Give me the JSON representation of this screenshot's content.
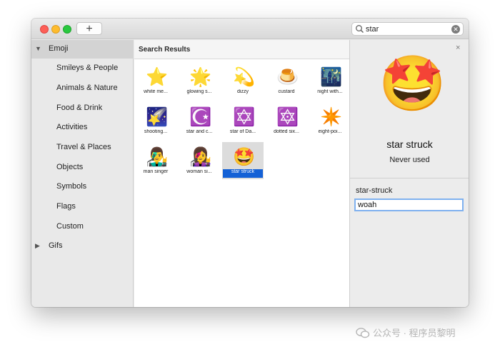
{
  "toolbar": {
    "add_label": "+"
  },
  "search": {
    "value": "star",
    "clear_label": "✕"
  },
  "sidebar": {
    "emoji_header": "Emoji",
    "items": [
      {
        "label": "Smileys & People"
      },
      {
        "label": "Animals & Nature"
      },
      {
        "label": "Food & Drink"
      },
      {
        "label": "Activities"
      },
      {
        "label": "Travel & Places"
      },
      {
        "label": "Objects"
      },
      {
        "label": "Symbols"
      },
      {
        "label": "Flags"
      },
      {
        "label": "Custom"
      }
    ],
    "gifs_label": "Gifs"
  },
  "results": {
    "header": "Search Results",
    "items": [
      {
        "glyph": "⭐",
        "label": "white me..."
      },
      {
        "glyph": "🌟",
        "label": "glowing s..."
      },
      {
        "glyph": "💫",
        "label": "dizzy"
      },
      {
        "glyph": "🍮",
        "label": "custard"
      },
      {
        "glyph": "🌃",
        "label": "night with..."
      },
      {
        "glyph": "🌠",
        "label": "shooting..."
      },
      {
        "glyph": "☪️",
        "label": "star and c..."
      },
      {
        "glyph": "✡️",
        "label": "star of Da..."
      },
      {
        "glyph": "🔯",
        "label": "dotted six..."
      },
      {
        "glyph": "✴️",
        "label": "eight-poi..."
      },
      {
        "glyph": "👨‍🎤",
        "label": "man singer"
      },
      {
        "glyph": "👩‍🎤",
        "label": "woman si..."
      },
      {
        "glyph": "🤩",
        "label": "star struck"
      }
    ]
  },
  "detail": {
    "close_label": "×",
    "glyph": "🤩",
    "title": "star struck",
    "usage": "Never used",
    "short_name": "star-struck",
    "alias_value": "woah"
  },
  "watermark": {
    "text": "公众号 · 程序员黎明"
  },
  "colors": {
    "selection": "#1461d6",
    "focus_ring": "#7fb1ef"
  }
}
